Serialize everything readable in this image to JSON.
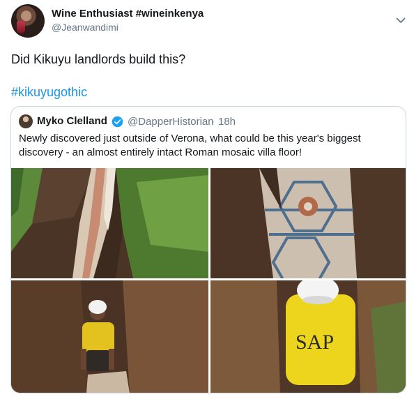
{
  "tweet": {
    "display_name": "Wine Enthusiast #wineinkenya",
    "handle": "@Jeanwandimi",
    "text": "Did Kikuyu landlords build this?",
    "hashtag": "#kikuyugothic"
  },
  "quoted_tweet": {
    "display_name": "Myko Clelland",
    "handle": "@DapperHistorian",
    "separator": "·",
    "time": "18h",
    "text": "Newly discovered just outside of Verona, what could be this year's biggest discovery - an almost entirely intact Roman mosaic villa floor!",
    "photos": [
      {
        "name": "trench-with-mosaic-strip"
      },
      {
        "name": "mosaic-closeup"
      },
      {
        "name": "worker-in-trench"
      },
      {
        "name": "worker-sap-shirt"
      }
    ],
    "helmet_text": "SAP"
  },
  "icons": {
    "menu": "chevron-down-icon",
    "verified": "verified-badge-icon"
  },
  "colors": {
    "link": "#1b95e0",
    "secondary_text": "#657786",
    "border": "#ccd6dd",
    "verified": "#1da1f2"
  }
}
